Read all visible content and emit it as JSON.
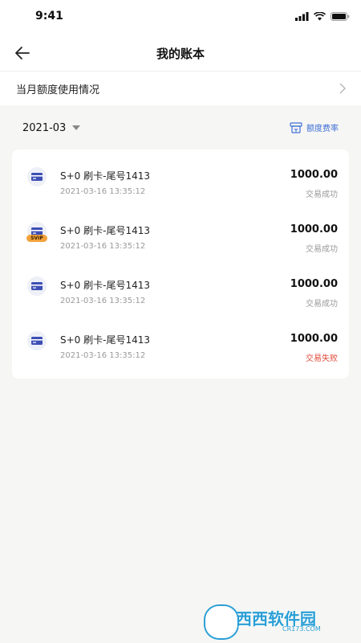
{
  "status_bar": {
    "time": "9:41"
  },
  "header": {
    "title": "我的账本"
  },
  "quota": {
    "label": "当月额度使用情况"
  },
  "filter": {
    "month": "2021-03",
    "rate_link": "额度费率"
  },
  "transactions": [
    {
      "title": "S+0 刷卡-尾号1413",
      "time": "2021-03-16 13:35:12",
      "amount": "1000.00",
      "status": "交易成功",
      "badge": ""
    },
    {
      "title": "S+0 刷卡-尾号1413",
      "time": "2021-03-16 13:35:12",
      "amount": "1000.00",
      "status": "交易成功",
      "badge": "SVIP"
    },
    {
      "title": "S+0 刷卡-尾号1413",
      "time": "2021-03-16 13:35:12",
      "amount": "1000.00",
      "status": "交易成功",
      "badge": ""
    },
    {
      "title": "S+0 刷卡-尾号1413",
      "time": "2021-03-16 13:35:12",
      "amount": "1000.00",
      "status": "交易失败",
      "badge": ""
    }
  ],
  "watermark": {
    "text": "西西软件园",
    "sub": "CR173.COM"
  },
  "colors": {
    "accent": "#3e6fd6",
    "fail": "#e24b3b",
    "muted": "#9a9a9a",
    "background": "#f6f6f4",
    "card_icon": "#3d4fb5",
    "badge": "#f2a23a"
  }
}
